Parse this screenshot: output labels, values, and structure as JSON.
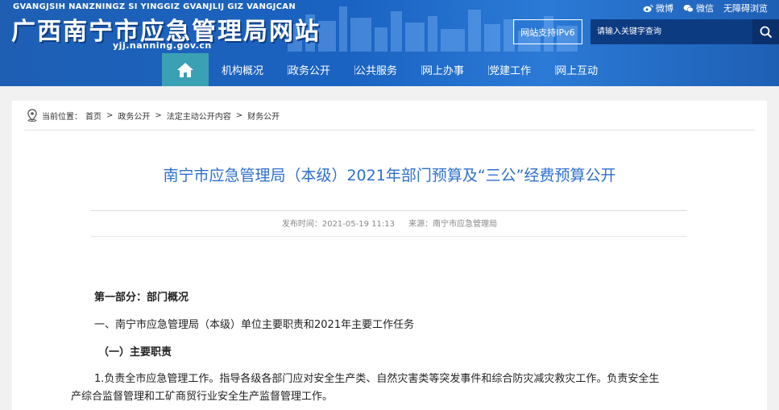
{
  "header": {
    "roman_name": "GVANGJSIH NANZNINGZ SI YINGGIZ GVANJLIJ GIZ VANGJCAN",
    "site_title": "广西南宁市应急管理局网站",
    "domain": "yjj.nanning.gov.cn",
    "top_links": [
      {
        "icon": "weibo-icon",
        "label": "微博"
      },
      {
        "icon": "wechat-icon",
        "label": "微信"
      },
      {
        "label": "无障碍浏览"
      }
    ],
    "ipv6_badge": "网站支持IPv6",
    "search": {
      "placeholder": "请输入关键字查询",
      "button_icon": "search-icon"
    }
  },
  "nav": {
    "home_icon": "home-icon",
    "items": [
      "机构概况",
      "政务公开",
      "公共服务",
      "网上办事",
      "党建工作",
      "网上互动"
    ],
    "home_bg": "#3aa0b4"
  },
  "breadcrumb": {
    "prefix": "当前位置：",
    "items": [
      "首页",
      "政务公开",
      "法定主动公开内容",
      "财务公开"
    ],
    "separator": ">"
  },
  "article": {
    "title": "南宁市应急管理局（本级）2021年部门预算及“三公”经费预算公开",
    "published_label": "发布时间：2021-05-19 11:13",
    "source_label": "来源：南宁市应急管理局",
    "paragraphs": [
      "第一部分：部门概况",
      "一、南宁市应急管理局（本级）单位主要职责和2021年主要工作任务",
      "（一）主要职责",
      "1.负责全市应急管理工作。指导各级各部门应对安全生产类、自然灾害类等突发事件和综合防灾减灾救灾工作。负责安全生",
      "产综合监督管理和工矿商贸行业安全生产监督管理工作。"
    ],
    "title_color": "#2d6fcf"
  },
  "colors": {
    "header_blue": "#1a63c2",
    "search_bg": "#0d3b82"
  }
}
